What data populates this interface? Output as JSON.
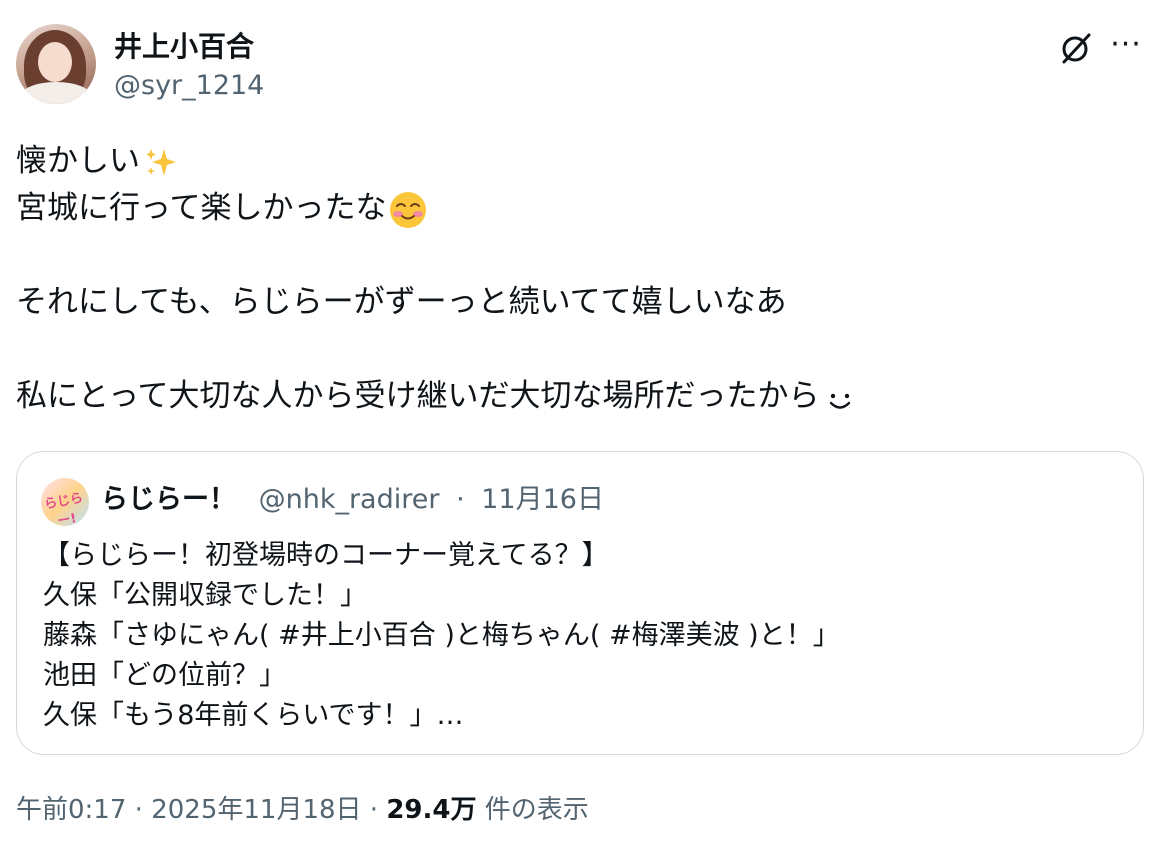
{
  "author": {
    "name": "井上小百合",
    "handle": "@syr_1214"
  },
  "header_icons": {
    "grok": "grok-icon",
    "more": "more-icon",
    "more_glyph": "···"
  },
  "tweet": {
    "lines": [
      "懐かしい",
      "宮城に行って楽しかったな",
      "",
      "それにしても、らじらーがずーっと続いてて嬉しいなあ",
      "",
      "私にとって大切な人から受け継いだ大切な場所だったから"
    ],
    "emojis": [
      "sparkles-icon",
      "smiling-face-icon",
      "smile-face-icon"
    ]
  },
  "quote": {
    "name": "らじらー！",
    "handle": "@nhk_radirer",
    "separator": "·",
    "date": "11月16日",
    "avatar_text": "らじらー!",
    "lines": [
      "【らじらー！初登場時のコーナー覚えてる？】",
      "久保「公開収録でした！」",
      "藤森「さゆにゃん( #井上小百合 )と梅ちゃん( #梅澤美波 )と！」",
      "池田「どの位前？」",
      "久保「もう8年前くらいです！」…"
    ]
  },
  "footer": {
    "time": "午前0:17",
    "sep1": "·",
    "date": "2025年11月18日",
    "sep2": "·",
    "views": "29.4万",
    "views_label": "件の表示"
  },
  "colors": {
    "text": "#0f1419",
    "secondary": "#536471",
    "border": "#cfd9de"
  }
}
